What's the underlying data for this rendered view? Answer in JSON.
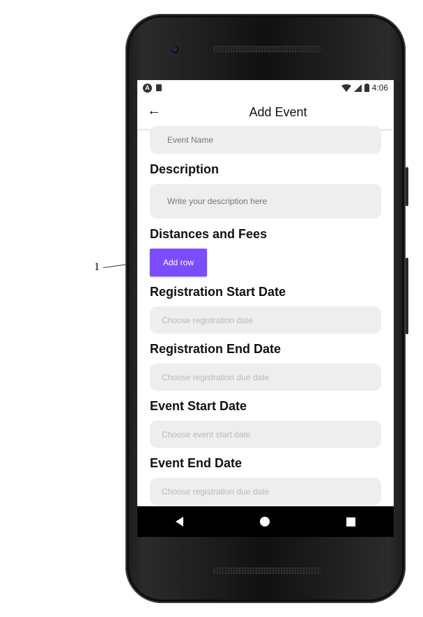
{
  "annotation": {
    "label": "1"
  },
  "status_bar": {
    "time": "4:06"
  },
  "app_bar": {
    "title": "Add Event"
  },
  "form": {
    "event_name_placeholder": "Event Name",
    "description_label": "Description",
    "description_placeholder": "Write your description here",
    "distances_label": "Distances and Fees",
    "add_row_label": "Add row",
    "reg_start_label": "Registration Start Date",
    "reg_start_placeholder": "Choose registration date",
    "reg_end_label": "Registration End Date",
    "reg_end_placeholder": "Choose registration due date",
    "event_start_label": "Event Start Date",
    "event_start_placeholder": "Choose event start date",
    "event_end_label": "Event End Date",
    "event_end_placeholder": "Choose registration due date"
  },
  "colors": {
    "accent": "#7c4dff",
    "field_bg": "#eeeeee"
  },
  "icons": {
    "back": "arrow-left",
    "nav_back": "triangle-back",
    "nav_home": "circle-home",
    "nav_recent": "square-recents"
  }
}
